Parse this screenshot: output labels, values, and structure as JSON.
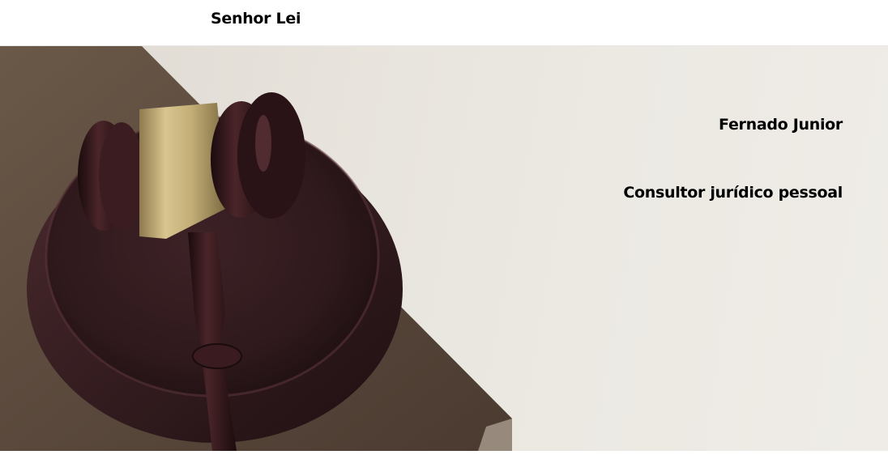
{
  "header": {
    "brand": "Senhor Lei"
  },
  "hero": {
    "name": "Fernado Junior",
    "role": "Consultor jurídico pessoal",
    "image_alt": "gavel-on-sound-block-image"
  },
  "colors": {
    "background": "#ffffff",
    "hero_bg": "#e9e5df",
    "book": "#5b4a3e",
    "wood": "#3a1f22",
    "brass": "#c9b37a",
    "text": "#000000"
  }
}
